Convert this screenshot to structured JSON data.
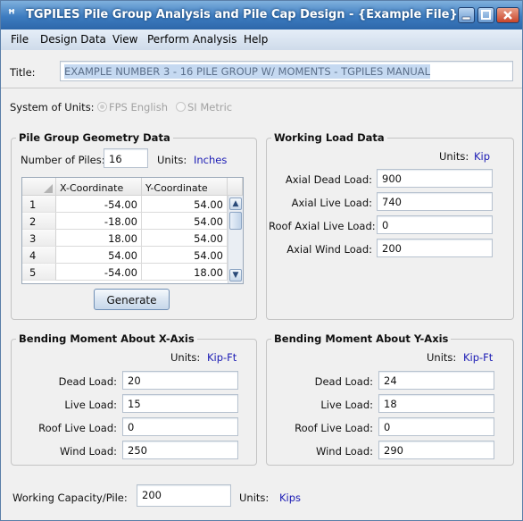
{
  "window": {
    "icon_glyph": "ꟸ",
    "title": "TGPILES Pile Group Analysis and Pile Cap Design  - {Example File}"
  },
  "menu": [
    "File",
    "Design Data",
    "View",
    "Perform Analysis",
    "Help"
  ],
  "title_field": {
    "label": "Title:",
    "value": "EXAMPLE NUMBER 3 - 16 PILE GROUP W/ MOMENTS - TGPILES MANUAL"
  },
  "units_system": {
    "label": "System of Units:",
    "options": [
      "FPS English",
      "SI Metric"
    ],
    "selected": "FPS English"
  },
  "geometry": {
    "title": "Pile Group Geometry Data",
    "num_piles_label": "Number of Piles:",
    "num_piles": "16",
    "units_label": "Units:",
    "units": "Inches",
    "columns": [
      "X-Coordinate",
      "Y-Coordinate"
    ],
    "rows": [
      {
        "n": "1",
        "x": "-54.00",
        "y": "54.00"
      },
      {
        "n": "2",
        "x": "-18.00",
        "y": "54.00"
      },
      {
        "n": "3",
        "x": "18.00",
        "y": "54.00"
      },
      {
        "n": "4",
        "x": "54.00",
        "y": "54.00"
      },
      {
        "n": "5",
        "x": "-54.00",
        "y": "18.00"
      }
    ],
    "generate_label": "Generate"
  },
  "working_load": {
    "title": "Working Load Data",
    "units_label": "Units:",
    "units": "Kip",
    "fields": [
      {
        "label": "Axial Dead Load:",
        "value": "900"
      },
      {
        "label": "Axial Live Load:",
        "value": "740"
      },
      {
        "label": "Roof Axial Live Load:",
        "value": "0"
      },
      {
        "label": "Axial Wind Load:",
        "value": "200"
      }
    ]
  },
  "moment_x": {
    "title": "Bending Moment About X-Axis",
    "units_label": "Units:",
    "units": "Kip-Ft",
    "fields": [
      {
        "label": "Dead Load:",
        "value": "20"
      },
      {
        "label": "Live Load:",
        "value": "15"
      },
      {
        "label": "Roof Live Load:",
        "value": "0"
      },
      {
        "label": "Wind Load:",
        "value": "250"
      }
    ]
  },
  "moment_y": {
    "title": "Bending Moment About Y-Axis",
    "units_label": "Units:",
    "units": "Kip-Ft",
    "fields": [
      {
        "label": "Dead Load:",
        "value": "24"
      },
      {
        "label": "Live Load:",
        "value": "18"
      },
      {
        "label": "Roof Live Load:",
        "value": "0"
      },
      {
        "label": "Wind Load:",
        "value": "290"
      }
    ]
  },
  "capacity": {
    "label": "Working Capacity/Pile:",
    "value": "200",
    "units_label": "Units:",
    "units": "Kips"
  },
  "colors": {
    "title_bar": "#3d7cc0",
    "menu_bar": "#dbe4ef",
    "units_text": "#1a1ab4",
    "title_selection": "#c5d9f1"
  }
}
